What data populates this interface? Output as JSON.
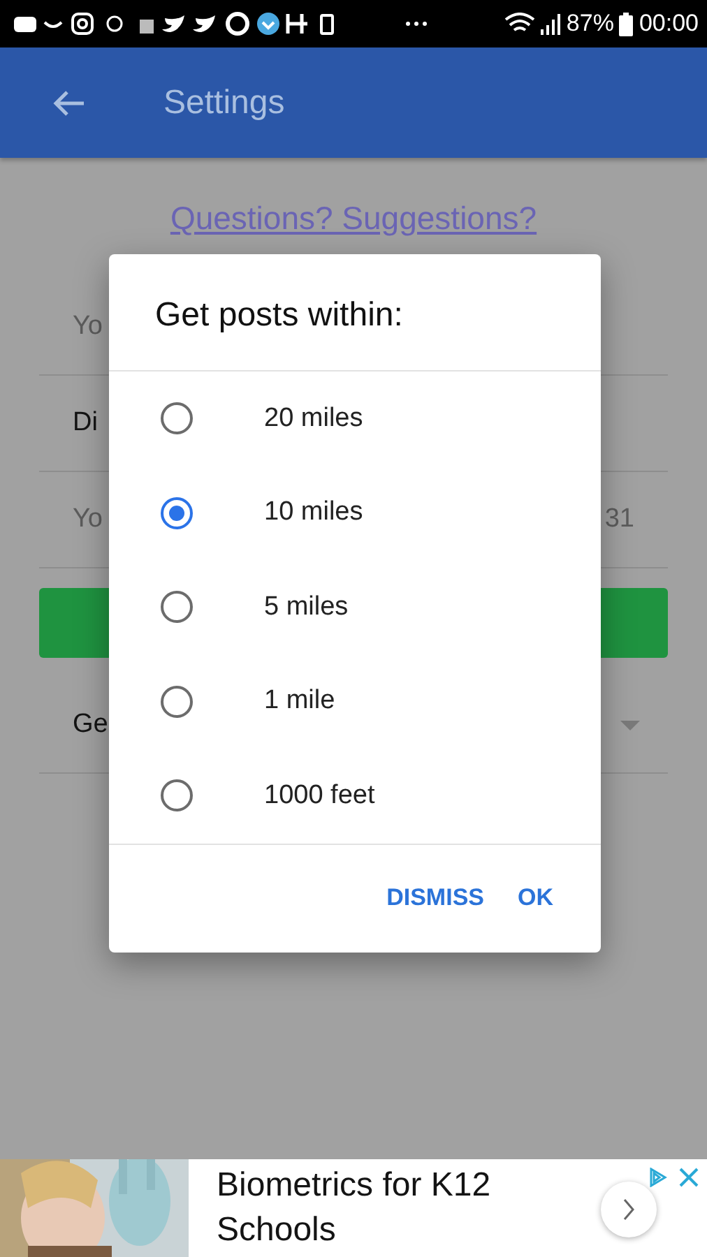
{
  "status_bar": {
    "battery": "87%",
    "time": "00:00"
  },
  "app_bar": {
    "title": "Settings"
  },
  "page": {
    "link": "Questions? Suggestions?",
    "rows": [
      {
        "kind": "placeholder",
        "text": "Yo"
      },
      {
        "kind": "label",
        "text": "Di"
      },
      {
        "kind": "placeholder",
        "text": "Yo",
        "trailing": "31"
      },
      {
        "kind": "button"
      },
      {
        "kind": "dropdown",
        "text": "Ge"
      }
    ]
  },
  "dialog": {
    "title": "Get posts within:",
    "options": [
      {
        "label": "20 miles",
        "selected": false
      },
      {
        "label": "10 miles",
        "selected": true
      },
      {
        "label": "5 miles",
        "selected": false
      },
      {
        "label": "1 mile",
        "selected": false
      },
      {
        "label": "1000 feet",
        "selected": false
      }
    ],
    "buttons": [
      "DISMISS",
      "OK"
    ]
  },
  "ad": {
    "headline": "Biometrics for K12 Schools"
  }
}
